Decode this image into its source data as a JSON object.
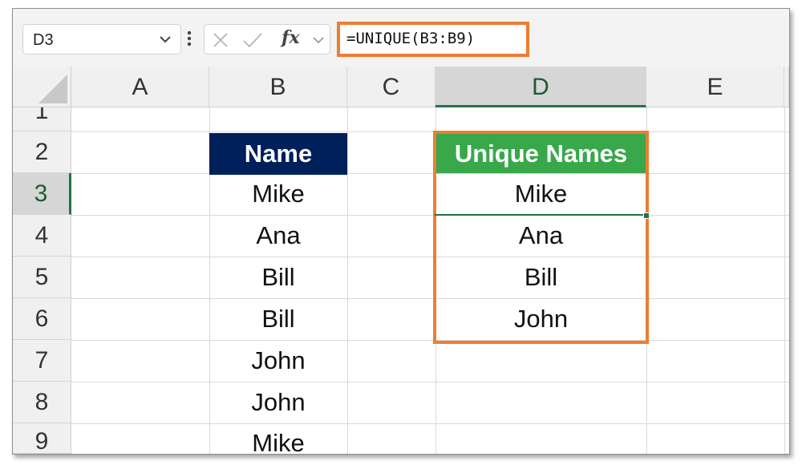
{
  "formula_bar": {
    "name_box": "D3",
    "formula": "=UNIQUE(B3:B9)",
    "fx_label": "fx"
  },
  "columns": [
    "A",
    "B",
    "C",
    "D",
    "E"
  ],
  "selected_column": "D",
  "rows": [
    "1",
    "2",
    "3",
    "4",
    "5",
    "6",
    "7",
    "8",
    "9"
  ],
  "selected_row": "3",
  "cells": {
    "B2": "Name",
    "B3": "Mike",
    "B4": "Ana",
    "B5": "Bill",
    "B6": "Bill",
    "B7": "John",
    "B8": "John",
    "B9": "Mike",
    "D2": "Unique Names",
    "D3": "Mike",
    "D4": "Ana",
    "D5": "Bill",
    "D6": "John"
  },
  "colors": {
    "name_header_fill": "#00205b",
    "unique_header_fill": "#38a84b",
    "highlight_border": "#ed7d31",
    "selection": "#217346"
  }
}
